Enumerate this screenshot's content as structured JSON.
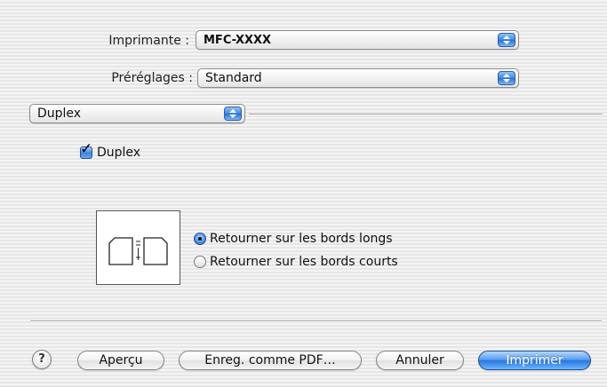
{
  "printer": {
    "label": "Imprimante :",
    "value": "MFC-XXXX"
  },
  "presets": {
    "label": "Préréglages :",
    "value": "Standard"
  },
  "panel_menu": {
    "value": "Duplex"
  },
  "duplex_checkbox": {
    "label": "Duplex",
    "checked": true
  },
  "binding": {
    "options": [
      {
        "label": "Retourner sur les bords longs",
        "selected": true
      },
      {
        "label": "Retourner sur les bords courts",
        "selected": false
      }
    ]
  },
  "buttons": {
    "help": "?",
    "preview": "Aperçu",
    "save_pdf": "Enreg. comme PDF…",
    "cancel": "Annuler",
    "print": "Imprimer"
  },
  "colors": {
    "accent": "#3d86e0",
    "default_button": "#2a76dc"
  },
  "icons": [
    "help-icon",
    "popup-arrows-icon",
    "checkmark-icon",
    "long-edge-binding-icon"
  ]
}
